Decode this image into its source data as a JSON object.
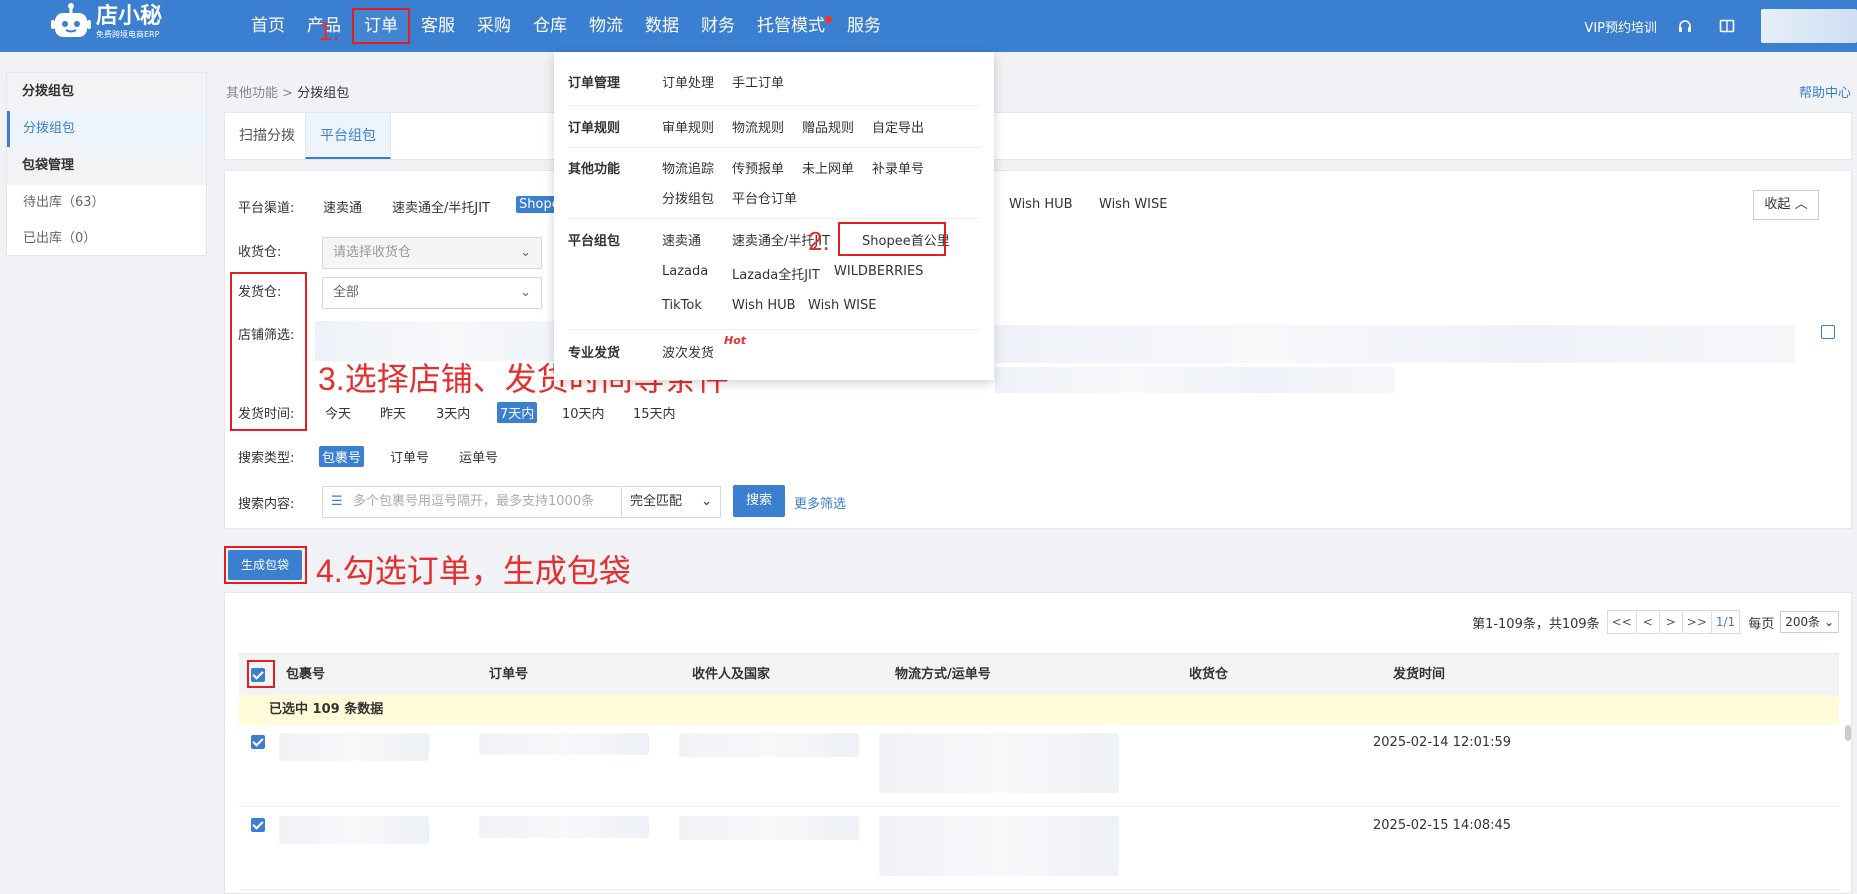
{
  "brand": {
    "name": "店小秘",
    "tagline": "免费跨境电商ERP"
  },
  "nav": {
    "items": [
      "首页",
      "产品",
      "订单",
      "客服",
      "采购",
      "仓库",
      "物流",
      "数据",
      "财务",
      "托管模式",
      "服务"
    ],
    "vip": "VIP预约培训"
  },
  "annotations": {
    "step1": "1.",
    "step2": "2.",
    "step3": "3.选择店铺、发货时间等条件",
    "step4": "4.勾选订单，生成包袋"
  },
  "sidebar": {
    "group1": "分拨组包",
    "item1": "分拨组包",
    "group2": "包袋管理",
    "item2": "待出库（63）",
    "item3": "已出库（0）"
  },
  "breadcrumb": {
    "parent": "其他功能",
    "sep": ">",
    "current": "分拨组包"
  },
  "help": "帮助中心",
  "tabs": [
    "扫描分拨",
    "平台组包"
  ],
  "filters": {
    "channel_label": "平台渠道:",
    "channel_opts": [
      "速卖通",
      "速卖通全/半托JIT",
      "Shopee",
      "Wish HUB",
      "Wish WISE"
    ],
    "collapse": "收起",
    "receive_label": "收货仓:",
    "receive_placeholder": "请选择收货仓",
    "ship_label": "发货仓:",
    "ship_value": "全部",
    "shop_label": "店铺筛选:",
    "time_label": "发货时间:",
    "time_opts": [
      "今天",
      "昨天",
      "3天内",
      "7天内",
      "10天内",
      "15天内"
    ],
    "type_label": "搜索类型:",
    "type_opts": [
      "包裹号",
      "订单号",
      "运单号"
    ],
    "content_label": "搜索内容:",
    "content_placeholder": "多个包裹号用逗号隔开，最多支持1000条",
    "match": "完全匹配",
    "search_btn": "搜索",
    "more": "更多筛选"
  },
  "generate_btn": "生成包袋",
  "dropdown": {
    "sections": [
      {
        "title": "订单管理",
        "links": [
          "订单处理",
          "手工订单"
        ]
      },
      {
        "title": "订单规则",
        "links": [
          "审单规则",
          "物流规则",
          "赠品规则",
          "自定导出"
        ]
      },
      {
        "title": "其他功能",
        "links": [
          "物流追踪",
          "传预报单",
          "未上网单",
          "补录单号",
          "分拨组包",
          "平台仓订单"
        ]
      },
      {
        "title": "平台组包",
        "links": [
          "速卖通",
          "速卖通全/半托JIT",
          "Shopee首公里",
          "Lazada",
          "Lazada全托JIT",
          "WILDBERRIES",
          "TikTok",
          "Wish HUB",
          "Wish WISE"
        ]
      },
      {
        "title": "专业发货",
        "links": [
          "波次发货"
        ]
      }
    ],
    "hot": "Hot"
  },
  "pager": {
    "summary": "第1-109条，共109条",
    "buttons": [
      "<<",
      "<",
      ">",
      ">>"
    ],
    "page": "1/1",
    "per_label": "每页",
    "per_value": "200条"
  },
  "table": {
    "headers": [
      "包裹号",
      "订单号",
      "收件人及国家",
      "物流方式/运单号",
      "收货仓",
      "发货时间"
    ],
    "selected_text": "已选中 109 条数据",
    "rows": [
      {
        "time": "2025-02-14 12:01:59"
      },
      {
        "time": "2025-02-15 14:08:45"
      }
    ]
  }
}
